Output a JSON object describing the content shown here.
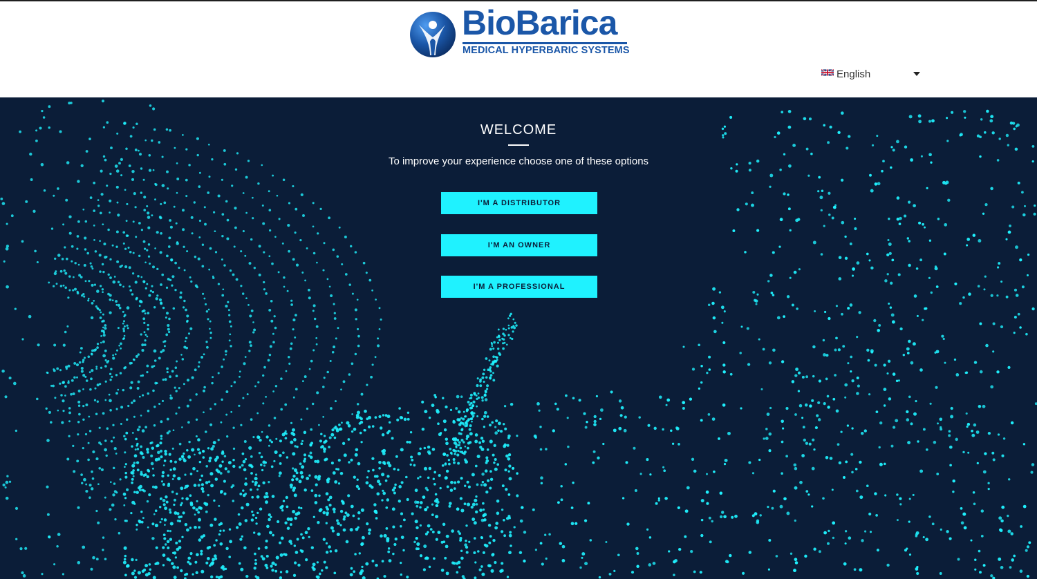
{
  "header": {
    "logo": {
      "name": "BioBarica",
      "tagline": "MEDICAL HYPERBARIC SYSTEMS"
    },
    "language": {
      "flag_icon": "uk-flag-icon",
      "selected": "English"
    }
  },
  "hero": {
    "title": "WELCOME",
    "subtitle": "To improve your experience choose one of these options",
    "buttons": [
      {
        "label": "I'M A DISTRIBUTOR"
      },
      {
        "label": "I'M AN OWNER"
      },
      {
        "label": "I'M A PROFESSIONAL"
      }
    ]
  },
  "colors": {
    "brand_blue": "#1b57a8",
    "hero_background": "#0b1d38",
    "accent_cyan": "#1ff2ff"
  }
}
